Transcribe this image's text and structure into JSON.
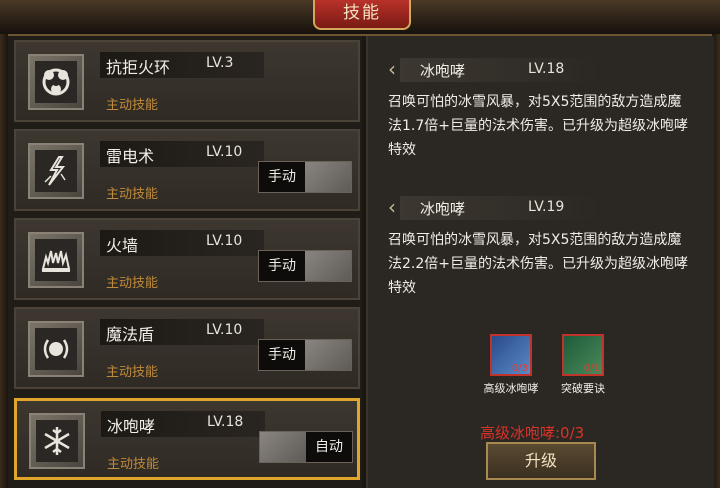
{
  "window": {
    "title": "技能"
  },
  "skills": [
    {
      "name": "抗拒火环",
      "level": "LV.3",
      "type": "主动技能",
      "icon": "fire-ring-icon"
    },
    {
      "name": "雷电术",
      "level": "LV.10",
      "type": "主动技能",
      "icon": "lightning-icon",
      "mode": "手动"
    },
    {
      "name": "火墙",
      "level": "LV.10",
      "type": "主动技能",
      "icon": "fire-wall-icon",
      "mode": "手动"
    },
    {
      "name": "魔法盾",
      "level": "LV.10",
      "type": "主动技能",
      "icon": "magic-shield-icon",
      "mode": "手动"
    },
    {
      "name": "冰咆哮",
      "level": "LV.18",
      "type": "主动技能",
      "icon": "snowflake-icon",
      "mode": "自动"
    }
  ],
  "current": {
    "name": "冰咆哮",
    "level": "LV.18",
    "description": "召唤可怕的冰雪风暴，对5X5范围的敌方造成魔法1.7倍+巨量的法术伤害。已升级为超级冰咆哮特效"
  },
  "next": {
    "name": "冰咆哮",
    "level": "LV.19",
    "description": "召唤可怕的冰雪风暴，对5X5范围的敌方造成魔法2.2倍+巨量的法术伤害。已升级为超级冰咆哮特效"
  },
  "materials": [
    {
      "name": "高级冰咆哮",
      "count": "0/3",
      "icon": "ice-book-icon"
    },
    {
      "name": "突破要诀",
      "count": "0/1",
      "icon": "green-book-icon"
    }
  ],
  "upgrade": {
    "status": "高级冰咆哮:0/3",
    "button_label": "升级"
  },
  "colors": {
    "selected_border": "#e0a62c",
    "skill_type": "#c08a3a",
    "warning": "#d8332a",
    "title_tab": "#b8322a"
  }
}
